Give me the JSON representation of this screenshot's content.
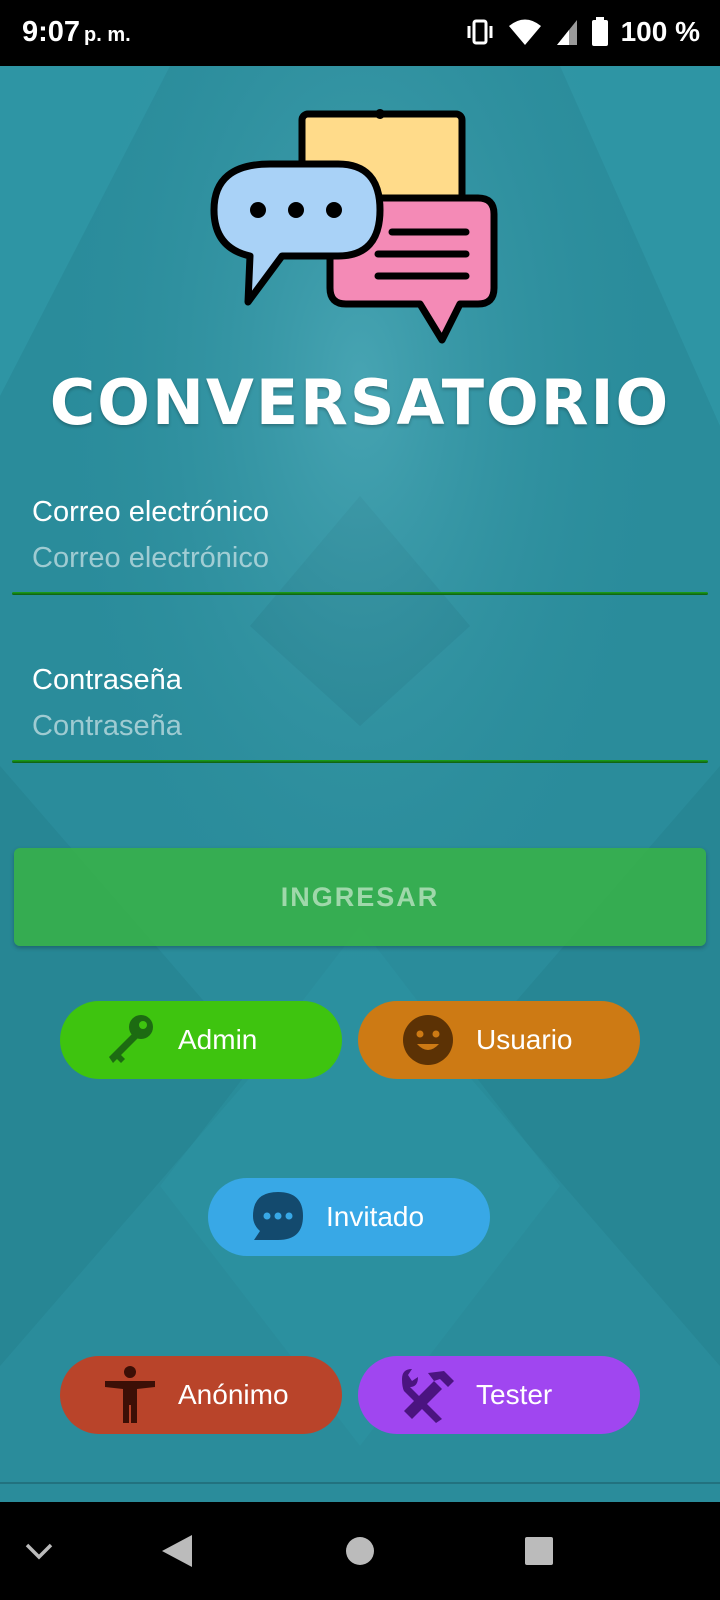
{
  "status_bar": {
    "time": "9:07",
    "ampm": "p. m.",
    "battery": "100 %"
  },
  "app": {
    "title": "CONVERSATORIO",
    "email": {
      "label": "Correo electrónico",
      "placeholder": "Correo electrónico",
      "value": ""
    },
    "password": {
      "label": "Contraseña",
      "placeholder": "Contraseña",
      "value": ""
    },
    "login_button": "INGRESAR",
    "roles": [
      {
        "label": "Admin",
        "color": "#3ec40f",
        "icon": "key-icon"
      },
      {
        "label": "Usuario",
        "color": "#cd7a14",
        "icon": "smiley-icon"
      },
      {
        "label": "Invitado",
        "color": "#38a8e6",
        "icon": "chat-bubble-icon"
      },
      {
        "label": "Anónimo",
        "color": "#b9442a",
        "icon": "person-icon"
      },
      {
        "label": "Tester",
        "color": "#a046f0",
        "icon": "tools-icon"
      }
    ],
    "colors": {
      "background": "#2a8c9b",
      "field_underline": "#1aa31a",
      "login_button": "#38b248"
    }
  },
  "nav_bar": {
    "icons": [
      "chevron-down-icon",
      "back-icon",
      "home-icon",
      "recents-icon"
    ]
  }
}
